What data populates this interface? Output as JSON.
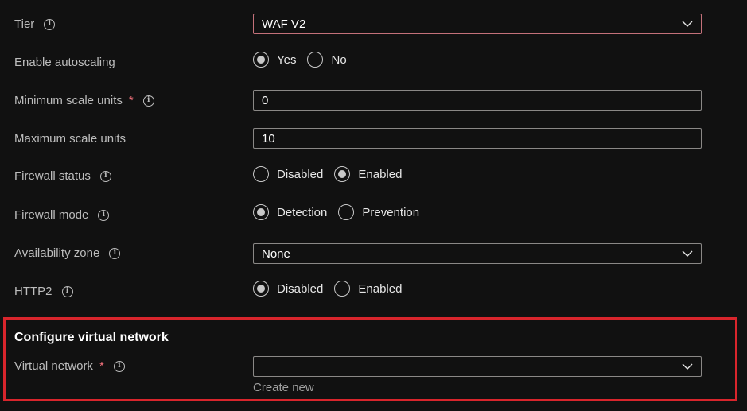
{
  "tier": {
    "label": "Tier",
    "value": "WAF V2"
  },
  "autoscaling": {
    "label": "Enable autoscaling",
    "options": [
      {
        "label": "Yes",
        "checked": true
      },
      {
        "label": "No",
        "checked": false
      }
    ]
  },
  "min_scale": {
    "label": "Minimum scale units",
    "required_mark": "*",
    "value": "0"
  },
  "max_scale": {
    "label": "Maximum scale units",
    "value": "10"
  },
  "firewall_status": {
    "label": "Firewall status",
    "options": [
      {
        "label": "Disabled",
        "checked": false
      },
      {
        "label": "Enabled",
        "checked": true
      }
    ]
  },
  "firewall_mode": {
    "label": "Firewall mode",
    "options": [
      {
        "label": "Detection",
        "checked": true
      },
      {
        "label": "Prevention",
        "checked": false
      }
    ]
  },
  "availability_zone": {
    "label": "Availability zone",
    "value": "None"
  },
  "http2": {
    "label": "HTTP2",
    "options": [
      {
        "label": "Disabled",
        "checked": true
      },
      {
        "label": "Enabled",
        "checked": false
      }
    ]
  },
  "vnet_section": {
    "title": "Configure virtual network",
    "label": "Virtual network",
    "required_mark": "*",
    "value": "",
    "create_new": "Create new"
  },
  "colors": {
    "highlight_border": "#d9252c",
    "required": "#f1707b",
    "active_border": "#c4717a"
  }
}
